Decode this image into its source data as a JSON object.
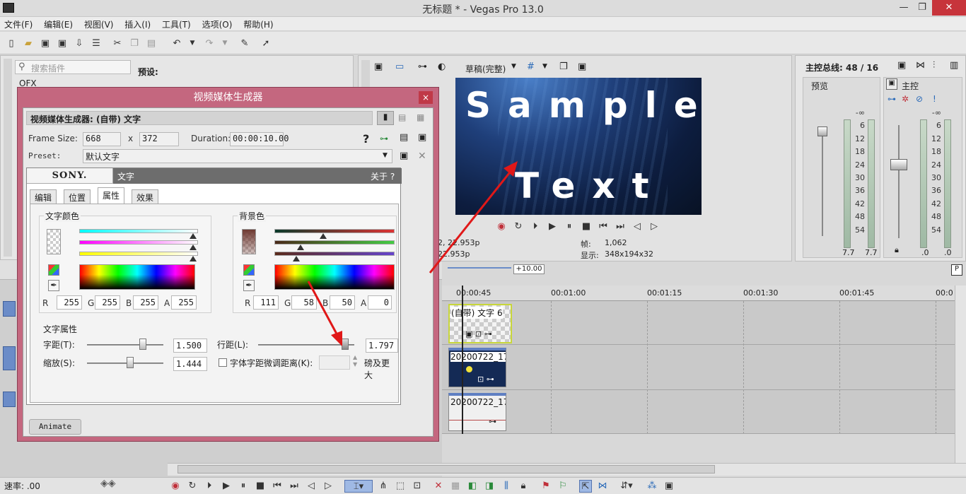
{
  "window": {
    "title": "无标题 * - Vegas Pro 13.0",
    "min": "—",
    "max": "❐",
    "close": "✕"
  },
  "menu": [
    "文件(F)",
    "编辑(E)",
    "视图(V)",
    "插入(I)",
    "工具(T)",
    "选项(O)",
    "帮助(H)"
  ],
  "plugin_panel": {
    "search_placeholder": "搜索插件",
    "tree_item": "OFX",
    "preset_label": "预设:"
  },
  "dialog": {
    "title": "视频媒体生成器",
    "close": "×",
    "header": "视频媒体生成器: (自带) 文字",
    "frame_size_label": "Frame Size:",
    "width": "668",
    "x": "x",
    "height": "372",
    "duration_label": "Duration:",
    "duration": "00:00:10.00",
    "help": "?",
    "preset_label": "Preset:",
    "preset_value": "默认文字",
    "brand": "SONY.",
    "plugin_name": "文字",
    "about": "关于 ?",
    "tabs": [
      "编辑",
      "位置",
      "属性",
      "效果"
    ],
    "text_color": {
      "title": "文字颜色",
      "R": "255",
      "G": "255",
      "B": "255",
      "A": "255"
    },
    "bg_color": {
      "title": "背景色",
      "R": "111",
      "G": "58",
      "B": "50",
      "A": "0"
    },
    "channel_labels": {
      "r": "R",
      "g": "G",
      "b": "B",
      "a": "A"
    },
    "props": {
      "title": "文字属性",
      "tracking_label": "字距(T):",
      "tracking": "1.500",
      "scale_label": "缩放(S):",
      "scale": "1.444",
      "leading_label": "行距(L):",
      "leading": "1.797",
      "kerning_label": "字体字距微调距离(K):",
      "larger_label": "磅及更大"
    },
    "animate": "Animate"
  },
  "preview_toolbar": {
    "quality": "草稿(完整)"
  },
  "preview": {
    "line1": "Sample",
    "line2": "Text",
    "timecode_1": "2, 22.953p",
    "timecode_2": "22.953p",
    "frame_label": "帧:",
    "frame": "1,062",
    "display_label": "显示:",
    "display": "348x194x32"
  },
  "master": {
    "title": "主控总线: 48 / 16",
    "preview_label": "预览",
    "master_label": "主控",
    "ticks": [
      "-∞",
      "6",
      "12",
      "18",
      "24",
      "30",
      "36",
      "42",
      "48",
      "54"
    ],
    "readout_l": "7.7",
    "readout_r": "7.7",
    "readout_m1": ".0",
    "readout_m2": ".0"
  },
  "timeline": {
    "offset": "+10.00",
    "marks": [
      "00:00:45",
      "00:01:00",
      "00:01:15",
      "00:01:30",
      "00:01:45",
      "00:0"
    ],
    "clips": [
      "(自带) 文字 6",
      "20200722_17",
      "20200722_17"
    ]
  },
  "status": {
    "rate": "速率: .00"
  }
}
